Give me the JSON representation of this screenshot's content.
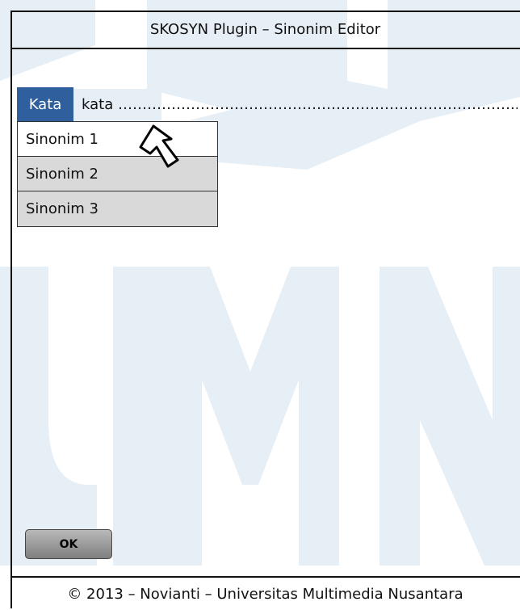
{
  "window": {
    "title": "SKOSYN Plugin – Sinonim Editor"
  },
  "word": {
    "label": "Kata",
    "value": "kata ……………………………………………………………………….."
  },
  "synonyms": [
    {
      "label": "Sinonim 1",
      "selected": true
    },
    {
      "label": "Sinonim 2",
      "selected": false
    },
    {
      "label": "Sinonim 3",
      "selected": false
    }
  ],
  "buttons": {
    "ok_label": "OK"
  },
  "footer": {
    "text": "© 2013 – Novianti – Universitas Multimedia Nusantara"
  },
  "colors": {
    "label_bg": "#2f5f9c",
    "item_bg": "#d9d9d9",
    "watermark": "#e4edf5"
  },
  "icons": {
    "cursor": "pointer-arrow-icon"
  }
}
